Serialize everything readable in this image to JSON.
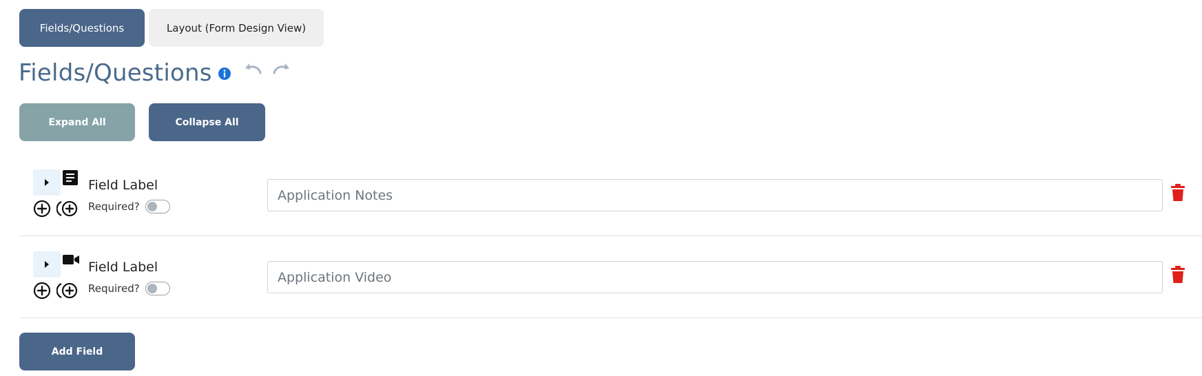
{
  "tabs": [
    {
      "label": "Fields/Questions",
      "active": true
    },
    {
      "label": "Layout (Form Design View)",
      "active": false
    }
  ],
  "heading": {
    "title": "Fields/Questions",
    "info_icon": "info-circle-icon",
    "undo_icon": "undo-icon",
    "redo_icon": "redo-icon"
  },
  "actions": {
    "expand_all": "Expand All",
    "collapse_all": "Collapse All",
    "add_field": "Add Field"
  },
  "fields": [
    {
      "label": "Field Label",
      "type_icon": "document-text-icon",
      "placeholder": "Application Notes",
      "required_label": "Required?",
      "required": false
    },
    {
      "label": "Field Label",
      "type_icon": "video-camera-icon",
      "placeholder": "Application Video",
      "required_label": "Required?",
      "required": false
    }
  ],
  "colors": {
    "primary": "#4a6689",
    "expand_button": "#86a3a8",
    "title": "#4a6a8c",
    "info": "#1a73d9",
    "delete": "#e0201a",
    "toggle_bg": "#e8f3fb"
  }
}
